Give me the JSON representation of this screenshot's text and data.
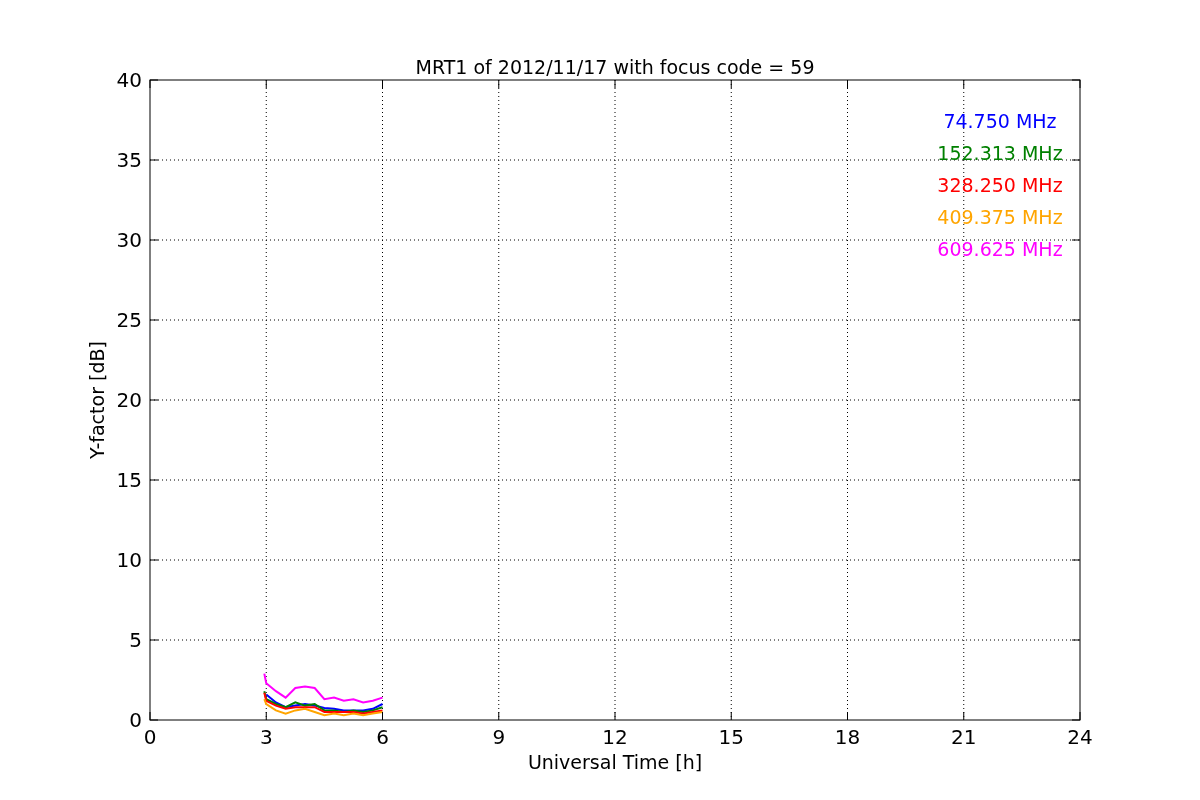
{
  "chart_data": {
    "type": "line",
    "title": "MRT1 of 2012/11/17 with focus code = 59",
    "xlabel": "Universal Time [h]",
    "ylabel": "Y-factor [dB]",
    "x": [
      2.95,
      3.0,
      3.25,
      3.5,
      3.75,
      4.0,
      4.25,
      4.5,
      4.75,
      5.0,
      5.25,
      5.5,
      5.75,
      6.0
    ],
    "series": [
      {
        "name": "74.750 MHz",
        "color": "#0000ff",
        "values": [
          null,
          1.6,
          1.1,
          0.8,
          0.9,
          1.0,
          0.9,
          0.75,
          0.7,
          0.6,
          0.6,
          0.6,
          0.7,
          1.0
        ]
      },
      {
        "name": "152.313 MHz",
        "color": "#008000",
        "values": [
          1.8,
          1.3,
          1.0,
          0.8,
          1.1,
          0.9,
          1.0,
          0.6,
          0.6,
          0.5,
          0.6,
          0.5,
          0.6,
          0.8
        ]
      },
      {
        "name": "328.250 MHz",
        "color": "#ff0000",
        "values": [
          1.7,
          1.2,
          0.9,
          0.7,
          0.8,
          0.8,
          0.8,
          0.5,
          0.5,
          0.5,
          0.5,
          0.4,
          0.5,
          0.6
        ]
      },
      {
        "name": "409.375 MHz",
        "color": "#ffa500",
        "values": [
          1.3,
          1.0,
          0.6,
          0.4,
          0.6,
          0.7,
          0.5,
          0.3,
          0.4,
          0.3,
          0.4,
          0.3,
          0.4,
          0.5
        ]
      },
      {
        "name": "609.625 MHz",
        "color": "#ff00ff",
        "values": [
          2.9,
          2.3,
          1.8,
          1.4,
          2.0,
          2.1,
          2.0,
          1.3,
          1.4,
          1.2,
          1.3,
          1.1,
          1.2,
          1.4
        ]
      }
    ],
    "grid": true,
    "xlim": [
      0,
      24
    ],
    "ylim": [
      0,
      40
    ],
    "xticks": [
      0,
      3,
      6,
      9,
      12,
      15,
      18,
      21,
      24
    ],
    "yticks": [
      0,
      5,
      10,
      15,
      20,
      25,
      30,
      35,
      40
    ]
  }
}
